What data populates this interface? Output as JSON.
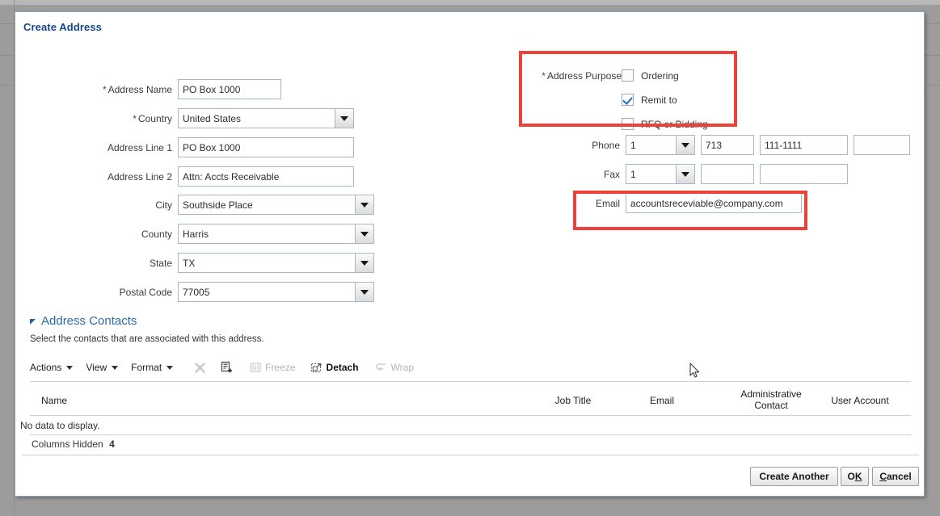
{
  "dialog": {
    "title": "Create Address"
  },
  "form_left": {
    "address_name": {
      "label": "Address Name",
      "value": "PO Box 1000",
      "required": true
    },
    "country": {
      "label": "Country",
      "value": "United States",
      "required": true
    },
    "address_line_1": {
      "label": "Address Line 1",
      "value": "PO Box 1000",
      "required": false
    },
    "address_line_2": {
      "label": "Address Line 2",
      "value": "Attn: Accts Receivable",
      "required": false
    },
    "city": {
      "label": "City",
      "value": "Southside Place",
      "required": false
    },
    "county": {
      "label": "County",
      "value": "Harris",
      "required": false
    },
    "state": {
      "label": "State",
      "value": "TX",
      "required": false
    },
    "postal_code": {
      "label": "Postal Code",
      "value": "77005",
      "required": false
    }
  },
  "address_purpose": {
    "label": "Address Purpose",
    "required": true,
    "options": [
      {
        "label": "Ordering",
        "checked": false
      },
      {
        "label": "Remit to",
        "checked": true
      },
      {
        "label": "RFQ or Bidding",
        "checked": false
      }
    ]
  },
  "phone": {
    "label": "Phone",
    "country_code": "1",
    "area_code": "713",
    "number": "111-1111",
    "extension": ""
  },
  "fax": {
    "label": "Fax",
    "country_code": "1",
    "area_code": "",
    "number": ""
  },
  "email": {
    "label": "Email",
    "value": "accountsreceviable@company.com"
  },
  "address_contacts": {
    "section_title": "Address Contacts",
    "description": "Select the contacts that are associated with this address.",
    "toolbar": {
      "menus": [
        {
          "label": "Actions",
          "icon": "chevron-down-icon"
        },
        {
          "label": "View",
          "icon": "chevron-down-icon"
        },
        {
          "label": "Format",
          "icon": "chevron-down-icon"
        }
      ],
      "buttons": [
        {
          "label": "",
          "icon": "delete-x-icon",
          "enabled": false
        },
        {
          "label": "",
          "icon": "add-row-icon",
          "enabled": true
        },
        {
          "label": "Freeze",
          "icon": "freeze-icon",
          "enabled": false
        },
        {
          "label": "Detach",
          "icon": "detach-icon",
          "enabled": true
        },
        {
          "label": "Wrap",
          "icon": "wrap-icon",
          "enabled": false
        }
      ]
    },
    "table": {
      "columns": [
        "Name",
        "Job Title",
        "Email",
        "Administrative Contact",
        "User Account"
      ],
      "rows": [],
      "empty_message": "No data to display.",
      "columns_hidden_label": "Columns Hidden",
      "columns_hidden_count": "4"
    }
  },
  "footer": {
    "buttons": [
      {
        "label": "Create Another",
        "accesskey": ""
      },
      {
        "label": "OK",
        "accesskey": "K"
      },
      {
        "label": "Cancel",
        "accesskey": "C"
      }
    ]
  },
  "annotations": {
    "highlight_color": "#ec4237",
    "boxes": [
      "address-purpose-highlight",
      "email-highlight"
    ]
  }
}
